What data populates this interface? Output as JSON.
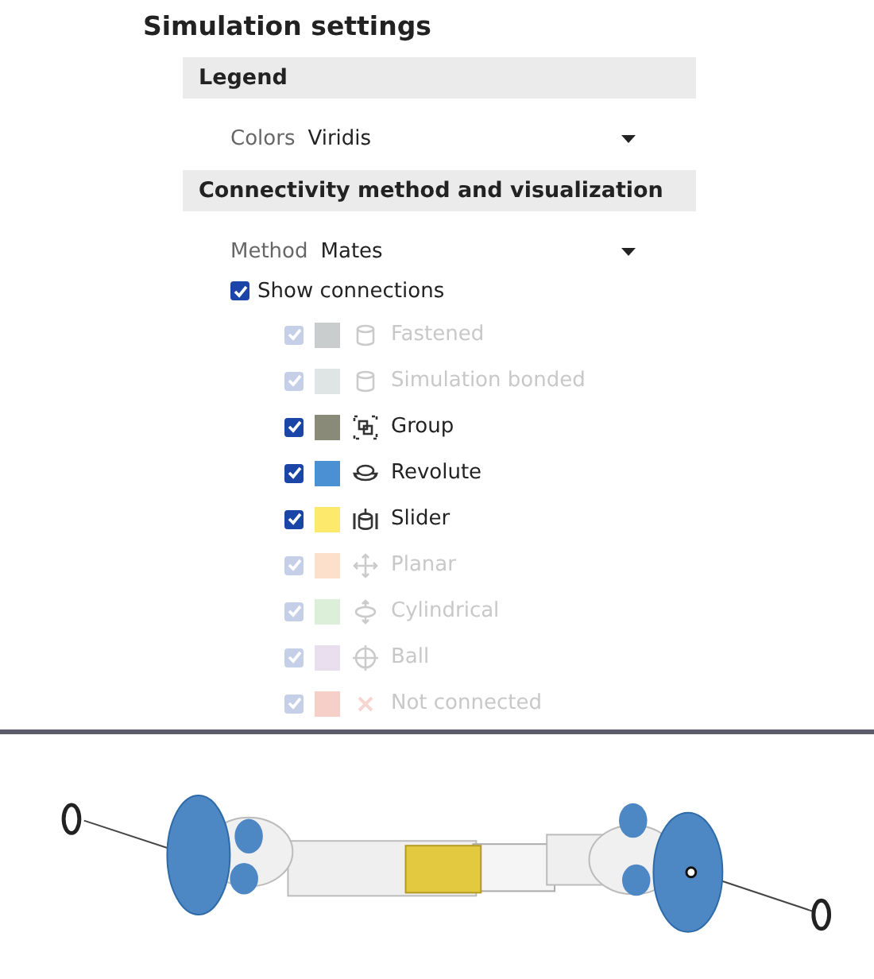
{
  "title": "Simulation settings",
  "sections": [
    {
      "heading": "Legend",
      "dropdown": {
        "label": "Colors",
        "value": "Viridis"
      }
    },
    {
      "heading": "Connectivity method and visualization",
      "dropdown": {
        "label": "Method",
        "value": "Mates"
      },
      "show_connections": {
        "label": "Show connections",
        "checked": true
      },
      "connections": [
        {
          "kind": "cylinder",
          "label": "Fastened",
          "checked": true,
          "disabled": true,
          "color": "#c9cdcd"
        },
        {
          "kind": "cylinder",
          "label": "Simulation bonded",
          "checked": true,
          "disabled": true,
          "color": "#dfe5e5"
        },
        {
          "kind": "group",
          "label": "Group",
          "checked": true,
          "disabled": false,
          "color": "#8a8a78"
        },
        {
          "kind": "revolute",
          "label": "Revolute",
          "checked": true,
          "disabled": false,
          "color": "#4a90d2"
        },
        {
          "kind": "slider",
          "label": "Slider",
          "checked": true,
          "disabled": false,
          "color": "#fde96c"
        },
        {
          "kind": "planar",
          "label": "Planar",
          "checked": true,
          "disabled": true,
          "color": "#fde0cc"
        },
        {
          "kind": "cylindrical",
          "label": "Cylindrical",
          "checked": true,
          "disabled": true,
          "color": "#dcefd8"
        },
        {
          "kind": "ball",
          "label": "Ball",
          "checked": true,
          "disabled": true,
          "color": "#eadfee"
        },
        {
          "kind": "none",
          "label": "Not connected",
          "checked": true,
          "disabled": true,
          "color": "#f6cfc8"
        }
      ]
    }
  ],
  "viewport": {
    "kind": "model"
  }
}
